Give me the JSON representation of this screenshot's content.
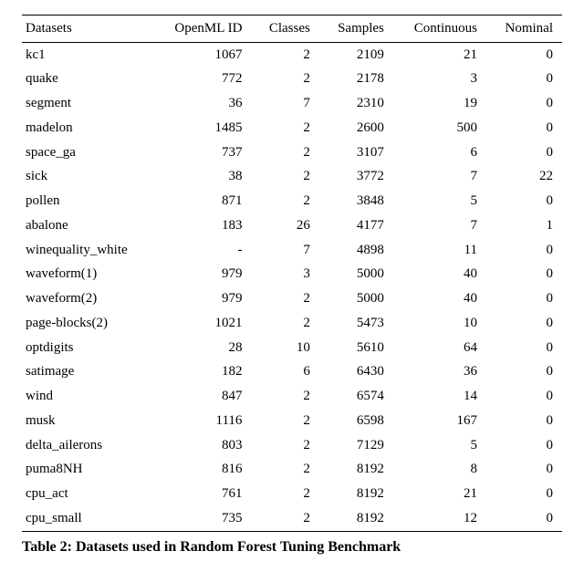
{
  "table": {
    "headers": [
      "Datasets",
      "OpenML ID",
      "Classes",
      "Samples",
      "Continuous",
      "Nominal"
    ],
    "rows": [
      {
        "cells": [
          "kc1",
          "1067",
          "2",
          "2109",
          "21",
          "0"
        ]
      },
      {
        "cells": [
          "quake",
          "772",
          "2",
          "2178",
          "3",
          "0"
        ]
      },
      {
        "cells": [
          "segment",
          "36",
          "7",
          "2310",
          "19",
          "0"
        ]
      },
      {
        "cells": [
          "madelon",
          "1485",
          "2",
          "2600",
          "500",
          "0"
        ]
      },
      {
        "cells": [
          "space_ga",
          "737",
          "2",
          "3107",
          "6",
          "0"
        ]
      },
      {
        "cells": [
          "sick",
          "38",
          "2",
          "3772",
          "7",
          "22"
        ]
      },
      {
        "cells": [
          "pollen",
          "871",
          "2",
          "3848",
          "5",
          "0"
        ]
      },
      {
        "cells": [
          "abalone",
          "183",
          "26",
          "4177",
          "7",
          "1"
        ]
      },
      {
        "cells": [
          "winequality_white",
          "-",
          "7",
          "4898",
          "11",
          "0"
        ]
      },
      {
        "cells": [
          "waveform(1)",
          "979",
          "3",
          "5000",
          "40",
          "0"
        ]
      },
      {
        "cells": [
          "waveform(2)",
          "979",
          "2",
          "5000",
          "40",
          "0"
        ]
      },
      {
        "cells": [
          "page-blocks(2)",
          "1021",
          "2",
          "5473",
          "10",
          "0"
        ]
      },
      {
        "cells": [
          "optdigits",
          "28",
          "10",
          "5610",
          "64",
          "0"
        ]
      },
      {
        "cells": [
          "satimage",
          "182",
          "6",
          "6430",
          "36",
          "0"
        ]
      },
      {
        "cells": [
          "wind",
          "847",
          "2",
          "6574",
          "14",
          "0"
        ]
      },
      {
        "cells": [
          "musk",
          "1116",
          "2",
          "6598",
          "167",
          "0"
        ]
      },
      {
        "cells": [
          "delta_ailerons",
          "803",
          "2",
          "7129",
          "5",
          "0"
        ]
      },
      {
        "cells": [
          "puma8NH",
          "816",
          "2",
          "8192",
          "8",
          "0"
        ]
      },
      {
        "cells": [
          "cpu_act",
          "761",
          "2",
          "8192",
          "21",
          "0"
        ]
      },
      {
        "cells": [
          "cpu_small",
          "735",
          "2",
          "8192",
          "12",
          "0"
        ]
      }
    ]
  },
  "caption": "Table 2: Datasets used in Random Forest Tuning Benchmark",
  "chart_data": {
    "type": "table",
    "title": "Table 2: Datasets used in Random Forest Tuning Benchmark",
    "columns": [
      "Datasets",
      "OpenML ID",
      "Classes",
      "Samples",
      "Continuous",
      "Nominal"
    ],
    "rows": [
      [
        "kc1",
        1067,
        2,
        2109,
        21,
        0
      ],
      [
        "quake",
        772,
        2,
        2178,
        3,
        0
      ],
      [
        "segment",
        36,
        7,
        2310,
        19,
        0
      ],
      [
        "madelon",
        1485,
        2,
        2600,
        500,
        0
      ],
      [
        "space_ga",
        737,
        2,
        3107,
        6,
        0
      ],
      [
        "sick",
        38,
        2,
        3772,
        7,
        22
      ],
      [
        "pollen",
        871,
        2,
        3848,
        5,
        0
      ],
      [
        "abalone",
        183,
        26,
        4177,
        7,
        1
      ],
      [
        "winequality_white",
        null,
        7,
        4898,
        11,
        0
      ],
      [
        "waveform(1)",
        979,
        3,
        5000,
        40,
        0
      ],
      [
        "waveform(2)",
        979,
        2,
        5000,
        40,
        0
      ],
      [
        "page-blocks(2)",
        1021,
        2,
        5473,
        10,
        0
      ],
      [
        "optdigits",
        28,
        10,
        5610,
        64,
        0
      ],
      [
        "satimage",
        182,
        6,
        6430,
        36,
        0
      ],
      [
        "wind",
        847,
        2,
        6574,
        14,
        0
      ],
      [
        "musk",
        1116,
        2,
        6598,
        167,
        0
      ],
      [
        "delta_ailerons",
        803,
        2,
        7129,
        5,
        0
      ],
      [
        "puma8NH",
        816,
        2,
        8192,
        8,
        0
      ],
      [
        "cpu_act",
        761,
        2,
        8192,
        21,
        0
      ],
      [
        "cpu_small",
        735,
        2,
        8192,
        12,
        0
      ]
    ]
  }
}
